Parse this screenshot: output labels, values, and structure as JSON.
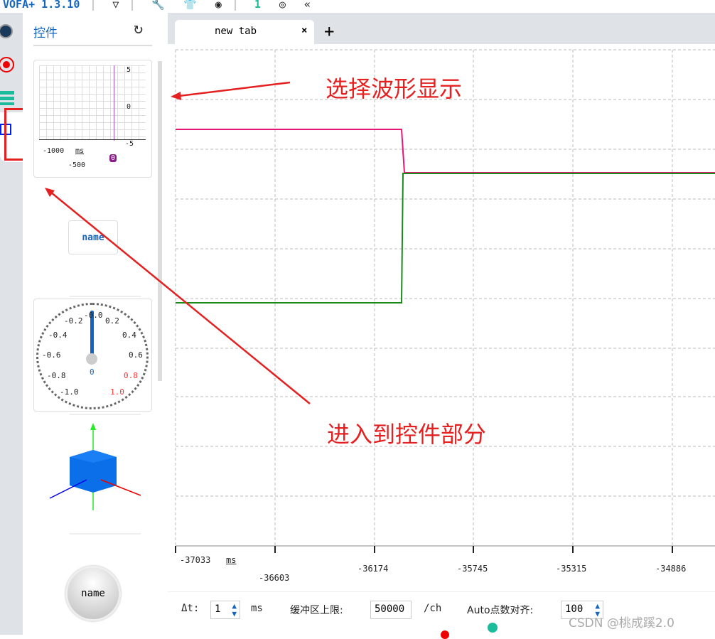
{
  "app": {
    "title": "VOFA+ 1.3.10",
    "badge": "1"
  },
  "toolbar": {
    "icons": [
      "vofa-logo-icon",
      "wrench-icon",
      "shirt-icon",
      "capture-icon",
      "count-badge",
      "fingerprint-icon",
      "collapse-icon"
    ]
  },
  "sidebar": {
    "title": "控件",
    "refresh_icon": "refresh-icon",
    "waveform": {
      "y_ticks": [
        "5",
        "0",
        "-5"
      ],
      "x_ticks": [
        "-1000",
        "-500"
      ],
      "unit": "ms",
      "cursor": "0"
    },
    "button_label": "name",
    "gauge": {
      "labels": [
        "-0.0",
        "-0.2",
        "0.2",
        "-0.4",
        "0.4",
        "-0.6",
        "0.6",
        "-0.8",
        "0.8",
        "-1.0",
        "1.0"
      ],
      "value": "0"
    },
    "round_button_label": "name"
  },
  "tabs": [
    {
      "label": "new tab"
    }
  ],
  "plot": {
    "x_ticks": [
      "-37033",
      "-36603",
      "-36174",
      "-35745",
      "-35315",
      "-34886"
    ],
    "x_unit": "ms",
    "colors": {
      "ch1": "#e8157a",
      "ch2": "#1a8a1a"
    }
  },
  "bottom": {
    "dt_label": "Δt:",
    "dt_value": "1",
    "dt_unit": "ms",
    "buffer_label": "缓冲区上限:",
    "buffer_value": "50000",
    "buffer_unit": "/ch",
    "auto_label": "Auto点数对齐:",
    "auto_value": "100"
  },
  "annotations": {
    "select": "选择波形显示",
    "enter": "进入到控件部分"
  },
  "watermark": "CSDN @桃成蹊2.0"
}
